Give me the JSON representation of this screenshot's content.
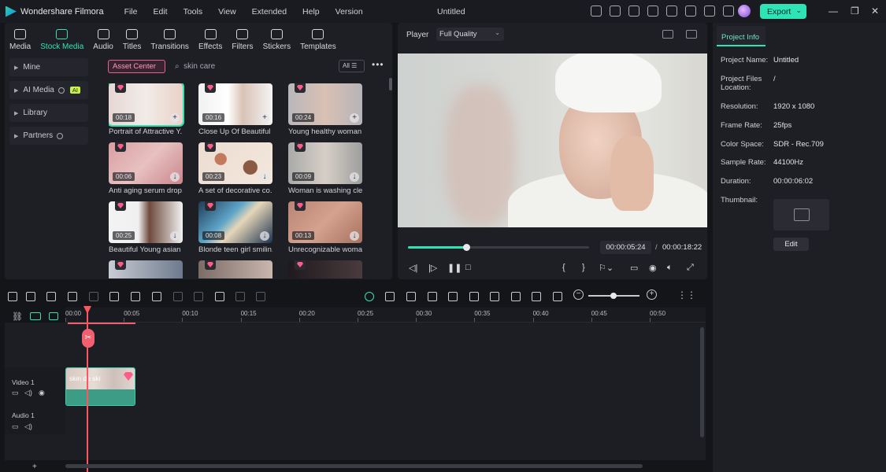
{
  "app": {
    "name": "Wondershare Filmora",
    "doc_title": "Untitled",
    "menu": [
      "File",
      "Edit",
      "Tools",
      "View",
      "Extended",
      "Help",
      "Version"
    ],
    "export_label": "Export",
    "accent_color": "#2ee3b6"
  },
  "media_tabs": [
    {
      "label": "Media",
      "icon": "media-icon"
    },
    {
      "label": "Stock Media",
      "icon": "stock-media-icon",
      "active": true
    },
    {
      "label": "Audio",
      "icon": "music-note-icon"
    },
    {
      "label": "Titles",
      "icon": "text-t-icon"
    },
    {
      "label": "Transitions",
      "icon": "transitions-icon"
    },
    {
      "label": "Effects",
      "icon": "effects-icon"
    },
    {
      "label": "Filters",
      "icon": "filters-icon"
    },
    {
      "label": "Stickers",
      "icon": "stickers-icon"
    },
    {
      "label": "Templates",
      "icon": "templates-icon"
    }
  ],
  "sidebar": {
    "items": [
      {
        "label": "Mine"
      },
      {
        "label": "AI Media",
        "badge": "AI"
      },
      {
        "label": "Library"
      },
      {
        "label": "Partners"
      }
    ]
  },
  "stock": {
    "asset_center": "Asset Center",
    "search_value": "skin care",
    "filter_label": "All",
    "cards": [
      {
        "title": "Portrait of Attractive Y...",
        "duration": "00:18"
      },
      {
        "title": "Close Up Of Beautiful ...",
        "duration": "00:16"
      },
      {
        "title": "Young healthy woman...",
        "duration": "00:24"
      },
      {
        "title": "Anti aging serum drop...",
        "duration": "00:06"
      },
      {
        "title": "A set of decorative co...",
        "duration": "00:23"
      },
      {
        "title": "Woman is washing cle...",
        "duration": "00:09"
      },
      {
        "title": "Beautiful Young asian ...",
        "duration": "00:25"
      },
      {
        "title": "Blonde teen girl smilin...",
        "duration": "00:08"
      },
      {
        "title": "Unrecognizable woma...",
        "duration": "00:13"
      }
    ]
  },
  "player": {
    "label": "Player",
    "quality": "Full Quality",
    "current_time": "00:00:05:24",
    "total_time": "00:00:18:22",
    "progress": 0.32
  },
  "project_info": {
    "tab": "Project Info",
    "rows": [
      {
        "label": "Project Name:",
        "value": "Untitled"
      },
      {
        "label": "Project Files Location:",
        "value": "/"
      },
      {
        "label": "Resolution:",
        "value": "1920 x 1080"
      },
      {
        "label": "Frame Rate:",
        "value": "25fps"
      },
      {
        "label": "Color Space:",
        "value": "SDR - Rec.709"
      },
      {
        "label": "Sample Rate:",
        "value": "44100Hz"
      },
      {
        "label": "Duration:",
        "value": "00:00:06:02"
      },
      {
        "label": "Thumbnail:",
        "value": ""
      }
    ],
    "edit_label": "Edit"
  },
  "timeline": {
    "ticks": [
      "00:00",
      "00:05",
      "00:10",
      "00:15",
      "00:20",
      "00:25",
      "00:30",
      "00:35",
      "00:40",
      "00:45",
      "00:50"
    ],
    "tracks": [
      "Video 1",
      "Audio 1"
    ],
    "clip_name": "skin do ski"
  }
}
